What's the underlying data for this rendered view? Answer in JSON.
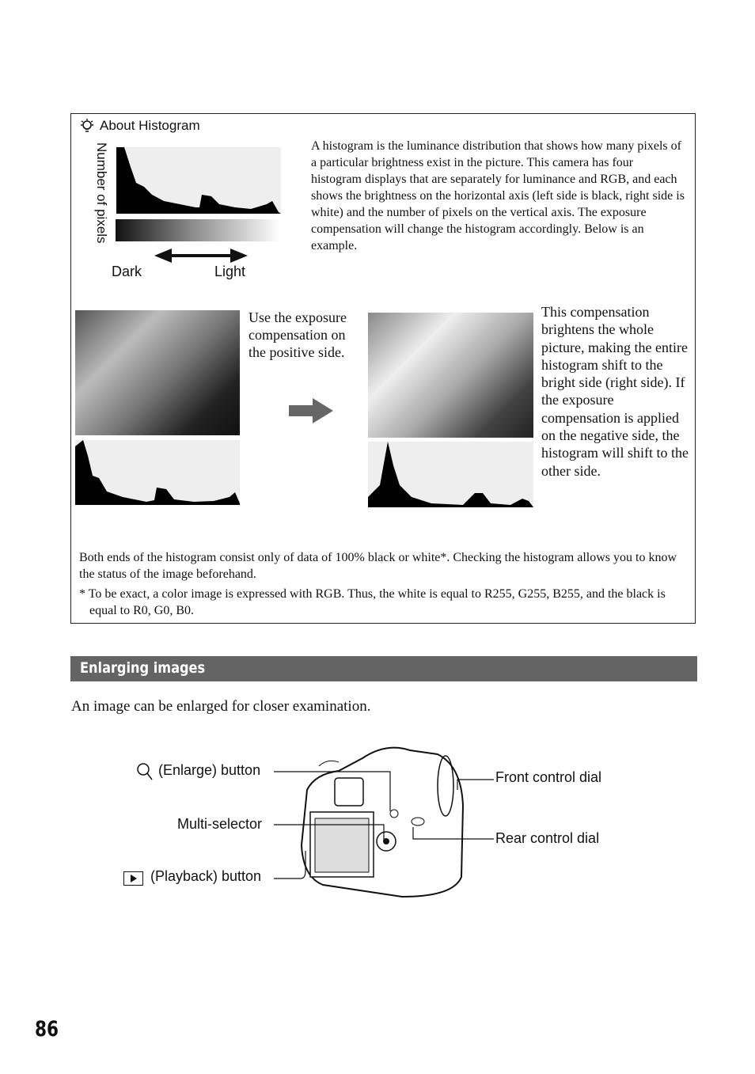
{
  "tip_box": {
    "icon": "lightbulb-hint-icon",
    "title": "About Histogram",
    "y_axis_label": "Number of pixels",
    "dark_label": "Dark",
    "light_label": "Light",
    "intro": "A histogram is the luminance distribution that shows how many pixels of a particular brightness exist in the picture. This camera has four histogram displays that are separately for luminance and RGB, and each shows the brightness on the horizontal axis (left side is black, right side is white) and the number of pixels on the vertical axis. The exposure compensation will change the histogram accordingly. Below is an example.",
    "use_positive": "Use the exposure compensation on the positive side.",
    "compensation_note": "This compensation brightens the whole picture, making the entire histogram shift to the bright side (right side). If the exposure compensation is applied on the negative side, the histogram will shift to the other side.",
    "both_ends": "Both ends of the histogram consist only of data of 100% black or white*. Checking the histogram allows you to know the status of the image beforehand.",
    "footnote": "* To be exact, a color image is expressed with RGB. Thus, the white is equal to R255, G255, B255, and the black is equal to R0, G0, B0."
  },
  "section": {
    "title": "Enlarging images",
    "body": "An image can be enlarged for closer examination."
  },
  "camera_labels": {
    "enlarge": "(Enlarge) button",
    "multi_selector": "Multi-selector",
    "playback": "(Playback) button",
    "front_dial": "Front control dial",
    "rear_dial": "Rear control dial"
  },
  "page_number": "86"
}
